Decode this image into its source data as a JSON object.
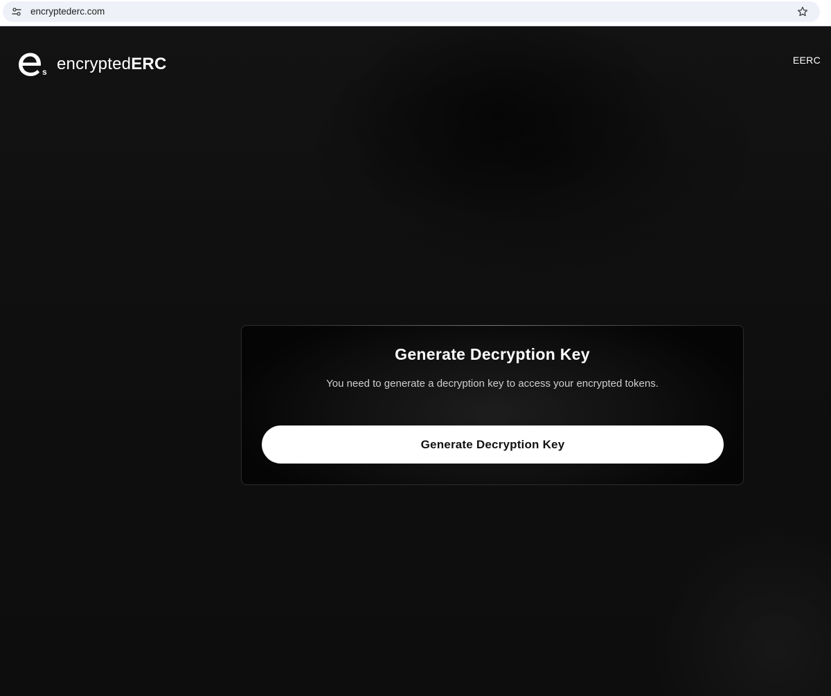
{
  "browser": {
    "url": "encryptederc.com",
    "site_info_icon": "tune-icon",
    "bookmark_icon": "star-outline-icon"
  },
  "header": {
    "logo_mark": "es",
    "logo_text_light": "encrypted",
    "logo_text_bold": "ERC",
    "nav_link": "EERC"
  },
  "card": {
    "title": "Generate Decryption Key",
    "description": "You need to generate a decryption key to access your encrypted tokens.",
    "button_label": "Generate Decryption Key"
  },
  "colors": {
    "background": "#0d0d0d",
    "card_background": "#111111",
    "button_background": "#ffffff",
    "button_text": "#111111",
    "text_primary": "#ffffff",
    "text_secondary": "#cfcfcf"
  }
}
